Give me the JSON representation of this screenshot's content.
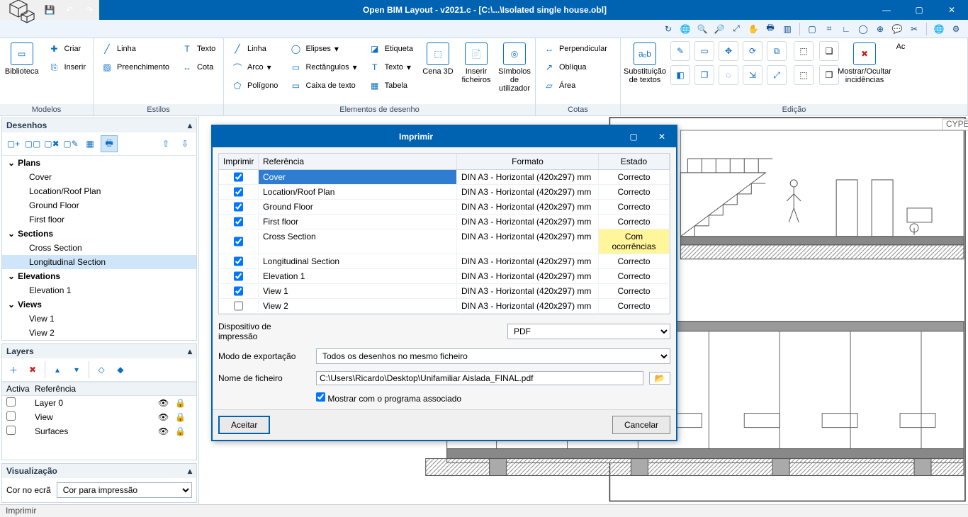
{
  "title": "Open BIM Layout - v2021.c - [C:\\...\\Isolated single house.obl]",
  "ribbon": {
    "groups": {
      "modelos": "Modelos",
      "estilos": "Estilos",
      "elementos": "Elementos de desenho",
      "cotas": "Cotas",
      "edicao": "Edição"
    },
    "biblioteca": "Biblioteca",
    "criar": "Criar",
    "inserir": "Inserir",
    "linha": "Linha",
    "texto": "Texto",
    "preenchimento": "Preenchimento",
    "cota": "Cota",
    "elipses": "Elipses",
    "arco": "Arco",
    "poligono": "Polígono",
    "rectangulos": "Rectângulos",
    "caixatexto": "Caixa de texto",
    "etiqueta": "Etiqueta",
    "texto2": "Texto",
    "tabela": "Tabela",
    "cena3d": "Cena 3D",
    "inserirfich": "Inserir ficheiros",
    "simbolos": "Símbolos de utilizador",
    "perpendicular": "Perpendicular",
    "obliqua": "Oblíqua",
    "area": "Área",
    "subst": "Substituição de textos",
    "mostrar": "Mostrar/Ocultar incidências",
    "ac": "Ac"
  },
  "panels": {
    "desenhos": "Desenhos",
    "layers": "Layers",
    "visualizacao": "Visualização"
  },
  "tree": {
    "plans": "Plans",
    "plans_items": [
      "Cover",
      "Location/Roof Plan",
      "Ground Floor",
      "First floor"
    ],
    "sections": "Sections",
    "sections_items": [
      "Cross Section",
      "Longitudinal Section"
    ],
    "elevations": "Elevations",
    "elevations_items": [
      "Elevation 1"
    ],
    "views": "Views",
    "views_items": [
      "View 1",
      "View 2"
    ]
  },
  "layers": {
    "head_activa": "Activa",
    "head_ref": "Referência",
    "rows": [
      "Layer 0",
      "View",
      "Surfaces"
    ]
  },
  "viz": {
    "label": "Cor no ecrã",
    "options": [
      "Cor para impressão"
    ]
  },
  "status": "Imprimir",
  "dialog": {
    "title": "Imprimir",
    "cols": {
      "imprimir": "Imprimir",
      "ref": "Referência",
      "formato": "Formato",
      "estado": "Estado"
    },
    "rows": [
      {
        "chk": true,
        "ref": "Cover",
        "fmt": "DIN A3 - Horizontal (420x297) mm",
        "est": "Correcto",
        "sel": true
      },
      {
        "chk": true,
        "ref": "Location/Roof Plan",
        "fmt": "DIN A3 - Horizontal (420x297) mm",
        "est": "Correcto"
      },
      {
        "chk": true,
        "ref": "Ground Floor",
        "fmt": "DIN A3 - Horizontal (420x297) mm",
        "est": "Correcto"
      },
      {
        "chk": true,
        "ref": "First floor",
        "fmt": "DIN A3 - Horizontal (420x297) mm",
        "est": "Correcto"
      },
      {
        "chk": true,
        "ref": "Cross Section",
        "fmt": "DIN A3 - Horizontal (420x297) mm",
        "est": "Com ocorrências",
        "warn": true
      },
      {
        "chk": true,
        "ref": "Longitudinal Section",
        "fmt": "DIN A3 - Horizontal (420x297) mm",
        "est": "Correcto"
      },
      {
        "chk": true,
        "ref": "Elevation 1",
        "fmt": "DIN A3 - Horizontal (420x297) mm",
        "est": "Correcto"
      },
      {
        "chk": true,
        "ref": "View 1",
        "fmt": "DIN A3 - Horizontal (420x297) mm",
        "est": "Correcto"
      },
      {
        "chk": false,
        "ref": "View 2",
        "fmt": "DIN A3 - Horizontal (420x297) mm",
        "est": "Correcto"
      }
    ],
    "dispositivo_lbl": "Dispositivo de impressão",
    "dispositivo_val": "PDF",
    "modo_lbl": "Modo de exportação",
    "modo_val": "Todos os desenhos no mesmo ficheiro",
    "nome_lbl": "Nome de ficheiro",
    "nome_val": "C:\\Users\\Ricardo\\Desktop\\Unifamiliar Aislada_FINAL.pdf",
    "mostrar_lbl": "Mostrar com o programa associado",
    "aceitar": "Aceitar",
    "cancelar": "Cancelar"
  }
}
